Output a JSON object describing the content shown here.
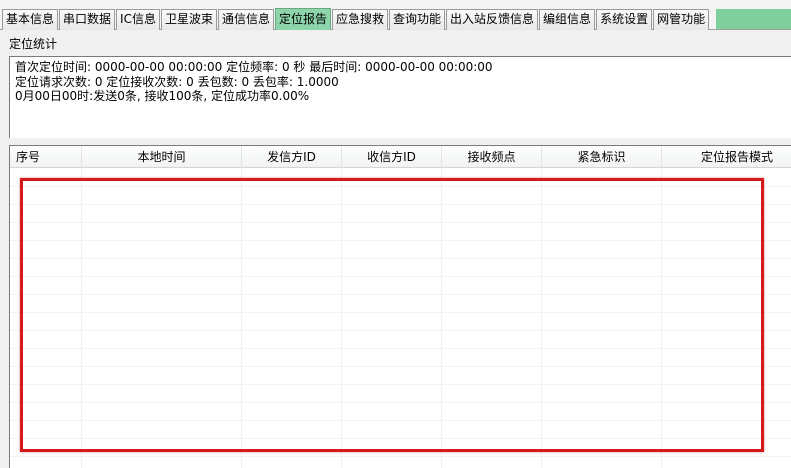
{
  "tabs": [
    {
      "label": "基本信息"
    },
    {
      "label": "串口数据"
    },
    {
      "label": "IC信息"
    },
    {
      "label": "卫星波束"
    },
    {
      "label": "通信信息"
    },
    {
      "label": "定位报告",
      "active": true
    },
    {
      "label": "应急搜救"
    },
    {
      "label": "查询功能"
    },
    {
      "label": "出入站反馈信息"
    },
    {
      "label": "编组信息"
    },
    {
      "label": "系统设置"
    },
    {
      "label": "网管功能"
    }
  ],
  "section": {
    "label": "定位统计"
  },
  "info": {
    "line1": "首次定位时间: 0000-00-00 00:00:00 定位频率: 0 秒 最后时间: 0000-00-00 00:00:00",
    "line2": "定位请求次数: 0 定位接收次数: 0 丢包数: 0 丢包率: 1.0000",
    "line3": "0月00日00时:发送0条, 接收100条, 定位成功率0.00%"
  },
  "table": {
    "columns": [
      "序号",
      "本地时间",
      "发信方ID",
      "收信方ID",
      "接收频点",
      "紧急标识",
      "定位报告模式"
    ],
    "rows": []
  },
  "colors": {
    "active_tab": "#8ed4aa",
    "annotation": "#d41a1a"
  }
}
